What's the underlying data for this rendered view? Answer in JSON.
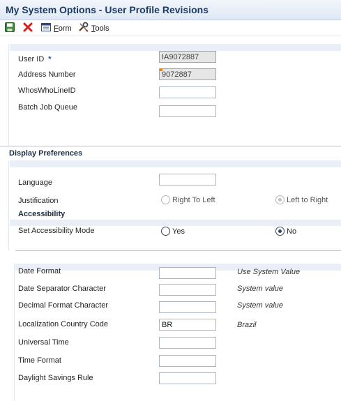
{
  "window": {
    "title": "My System Options - User Profile Revisions"
  },
  "toolbar": {
    "save_icon": "save-icon",
    "cancel_icon": "close-icon",
    "form_icon": "form-icon",
    "form_label_prefix": "",
    "form_label_ul": "F",
    "form_label_rest": "orm",
    "tools_icon": "tools-icon",
    "tools_label_ul": "T",
    "tools_label_rest": "ools"
  },
  "user": {
    "user_id_label": "User ID",
    "required_mark": "*",
    "user_id_value": "IA9072887",
    "address_number_label": "Address Number",
    "address_number_value": "9072887",
    "whoswho_label": "WhosWhoLineID",
    "whoswho_value": "",
    "batch_label": "Batch Job Queue",
    "batch_value": ""
  },
  "display": {
    "heading": "Display Preferences",
    "language_label": "Language",
    "language_value": "",
    "justification_label": "Justification",
    "justification_options": [
      "Right To Left",
      "Left to Right"
    ],
    "justification_selected": "Left to Right",
    "accessibility_heading": "Accessibility",
    "accessibility_label": "Set Accessibility Mode",
    "accessibility_options": [
      "Yes",
      "No"
    ],
    "accessibility_selected": "No"
  },
  "formats": {
    "date_format_label": "Date Format",
    "date_format_value": "",
    "date_format_desc": "Use System Value",
    "date_sep_label": "Date Separator Character",
    "date_sep_value": "",
    "date_sep_desc": "System value",
    "decimal_label": "Decimal Format Character",
    "decimal_value": "",
    "decimal_desc": "System value",
    "country_label": "Localization Country Code",
    "country_value": "BR",
    "country_desc": "Brazil",
    "universal_label": "Universal Time",
    "universal_value": "",
    "time_format_label": "Time Format",
    "time_format_value": "",
    "dst_label": "Daylight Savings Rule",
    "dst_value": ""
  },
  "colors": {
    "title": "#1d3b62",
    "band": "#e9eef7",
    "radio": "#2e4666"
  }
}
